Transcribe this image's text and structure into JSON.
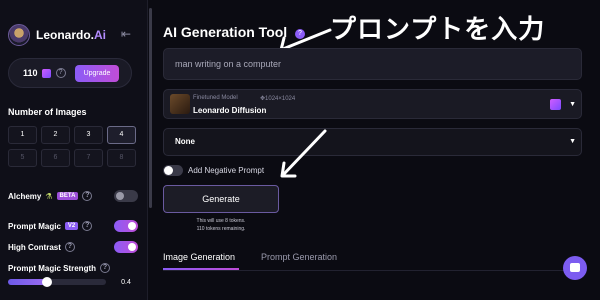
{
  "sidebar": {
    "brand": {
      "name": "Leonardo.",
      "suffix": "Ai"
    },
    "collapse_icon": "collapse-left-icon",
    "tokens": {
      "count": "110",
      "upgrade_label": "Upgrade"
    },
    "num_images": {
      "label": "Number of Images",
      "options": [
        "1",
        "2",
        "3",
        "4",
        "5",
        "6",
        "7",
        "8"
      ],
      "selected": "4"
    },
    "alchemy": {
      "label": "Alchemy",
      "badge": "BETA",
      "enabled": false
    },
    "prompt_magic": {
      "label": "Prompt Magic",
      "badge": "V2",
      "enabled": true
    },
    "high_contrast": {
      "label": "High Contrast",
      "enabled": true
    },
    "magic_strength": {
      "label": "Prompt Magic Strength",
      "value": "0.4",
      "fraction": 0.4
    }
  },
  "main": {
    "title": "AI Generation Tool",
    "annotation": "プロンプトを入力",
    "prompt_value": "man writing on a computer",
    "model": {
      "type_label": "Finetuned Model",
      "dimensions": "1024×1024",
      "name": "Leonardo Diffusion"
    },
    "style_select": "None",
    "negative_prompt_label": "Add Negative Prompt",
    "generate_label": "Generate",
    "generate_note_1": "This will use 8 tokens.",
    "generate_note_2": "110 tokens remaining.",
    "tabs": [
      {
        "label": "Image Generation",
        "active": true
      },
      {
        "label": "Prompt Generation",
        "active": false
      }
    ]
  },
  "colors": {
    "accent": "#8b5cf6",
    "accent2": "#c04dd8",
    "background": "#0b0b12"
  }
}
